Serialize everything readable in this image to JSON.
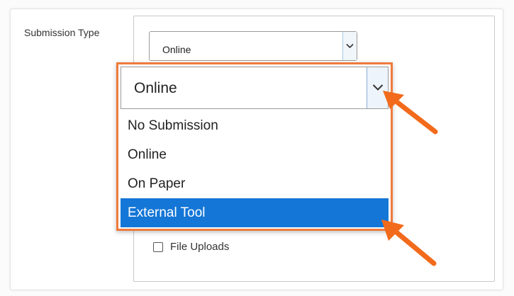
{
  "field": {
    "label": "Submission Type",
    "selected_value": "Online"
  },
  "dropdown": {
    "selected_value": "Online",
    "options": [
      {
        "label": "No Submission",
        "highlighted": false
      },
      {
        "label": "Online",
        "highlighted": false
      },
      {
        "label": "On Paper",
        "highlighted": false
      },
      {
        "label": "External Tool",
        "highlighted": true
      }
    ]
  },
  "file_uploads": {
    "label": "File Uploads",
    "checked": false
  },
  "colors": {
    "highlight": "#1476d6",
    "callout_border": "#f07a3c",
    "arrow": "#f26a1b"
  },
  "icons": [
    "chevron-down-icon",
    "pointer-arrow-icon",
    "checkbox-icon"
  ]
}
